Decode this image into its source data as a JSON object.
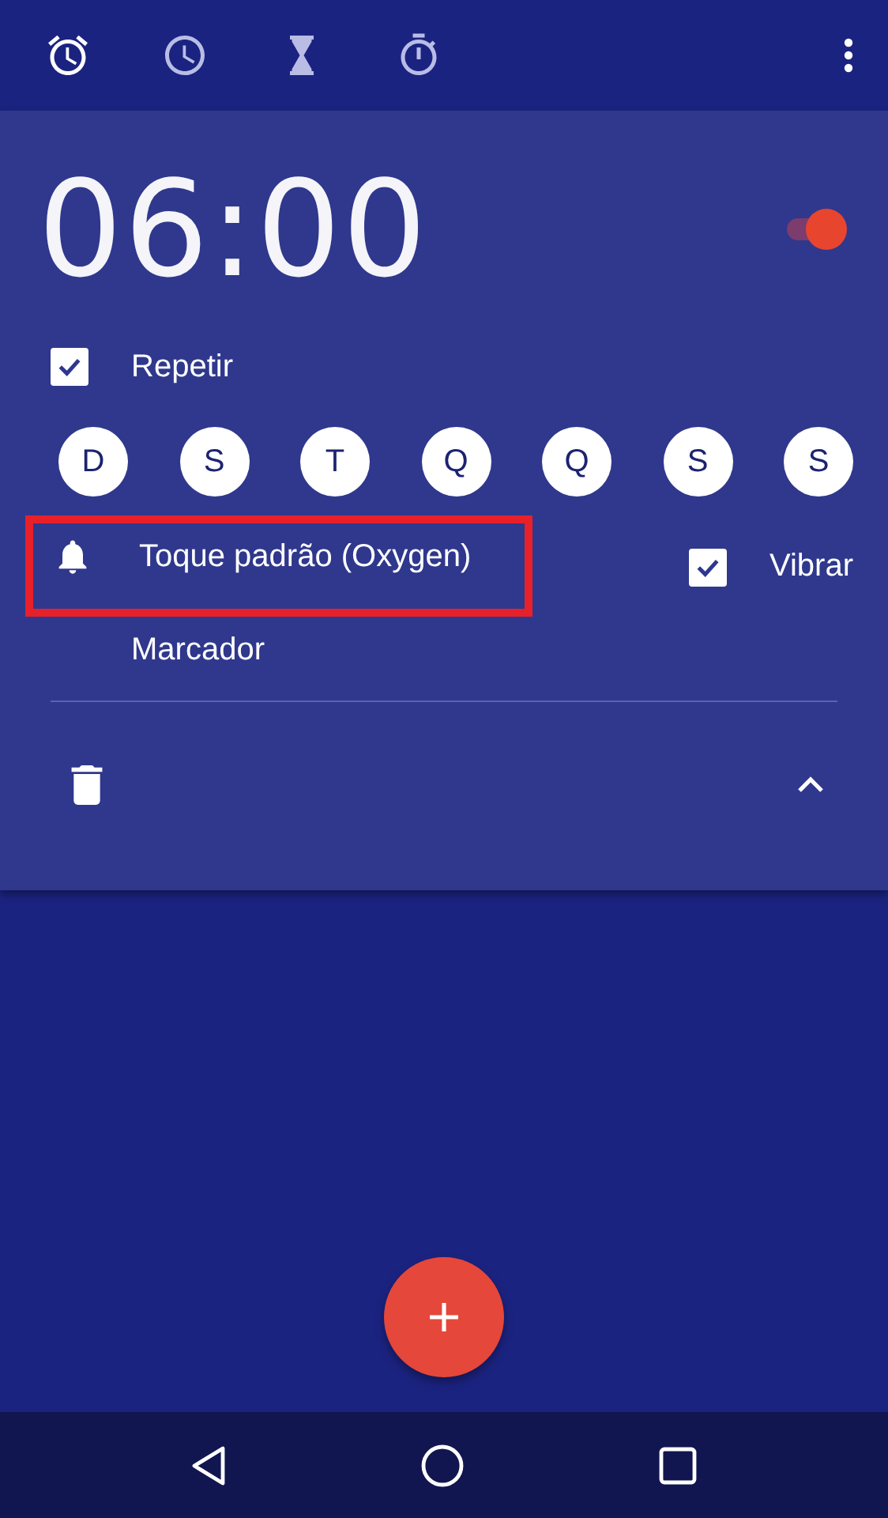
{
  "tabs": [
    {
      "kind": "alarm",
      "selected": true
    },
    {
      "kind": "clock",
      "selected": false
    },
    {
      "kind": "timer",
      "selected": false
    },
    {
      "kind": "stopwatch",
      "selected": false
    }
  ],
  "alarm": {
    "time": "06:00",
    "enabled": true,
    "repeat": {
      "label": "Repetir",
      "checked": true
    },
    "days": [
      {
        "label": "D",
        "selected": true
      },
      {
        "label": "S",
        "selected": true
      },
      {
        "label": "T",
        "selected": true
      },
      {
        "label": "Q",
        "selected": true
      },
      {
        "label": "Q",
        "selected": true
      },
      {
        "label": "S",
        "selected": true
      },
      {
        "label": "S",
        "selected": true
      }
    ],
    "ringtone": {
      "label": "Toque padrão (Oxygen)",
      "highlighted": true
    },
    "vibrate": {
      "label": "Vibrar",
      "checked": true
    },
    "label": "Marcador",
    "expanded": true
  }
}
